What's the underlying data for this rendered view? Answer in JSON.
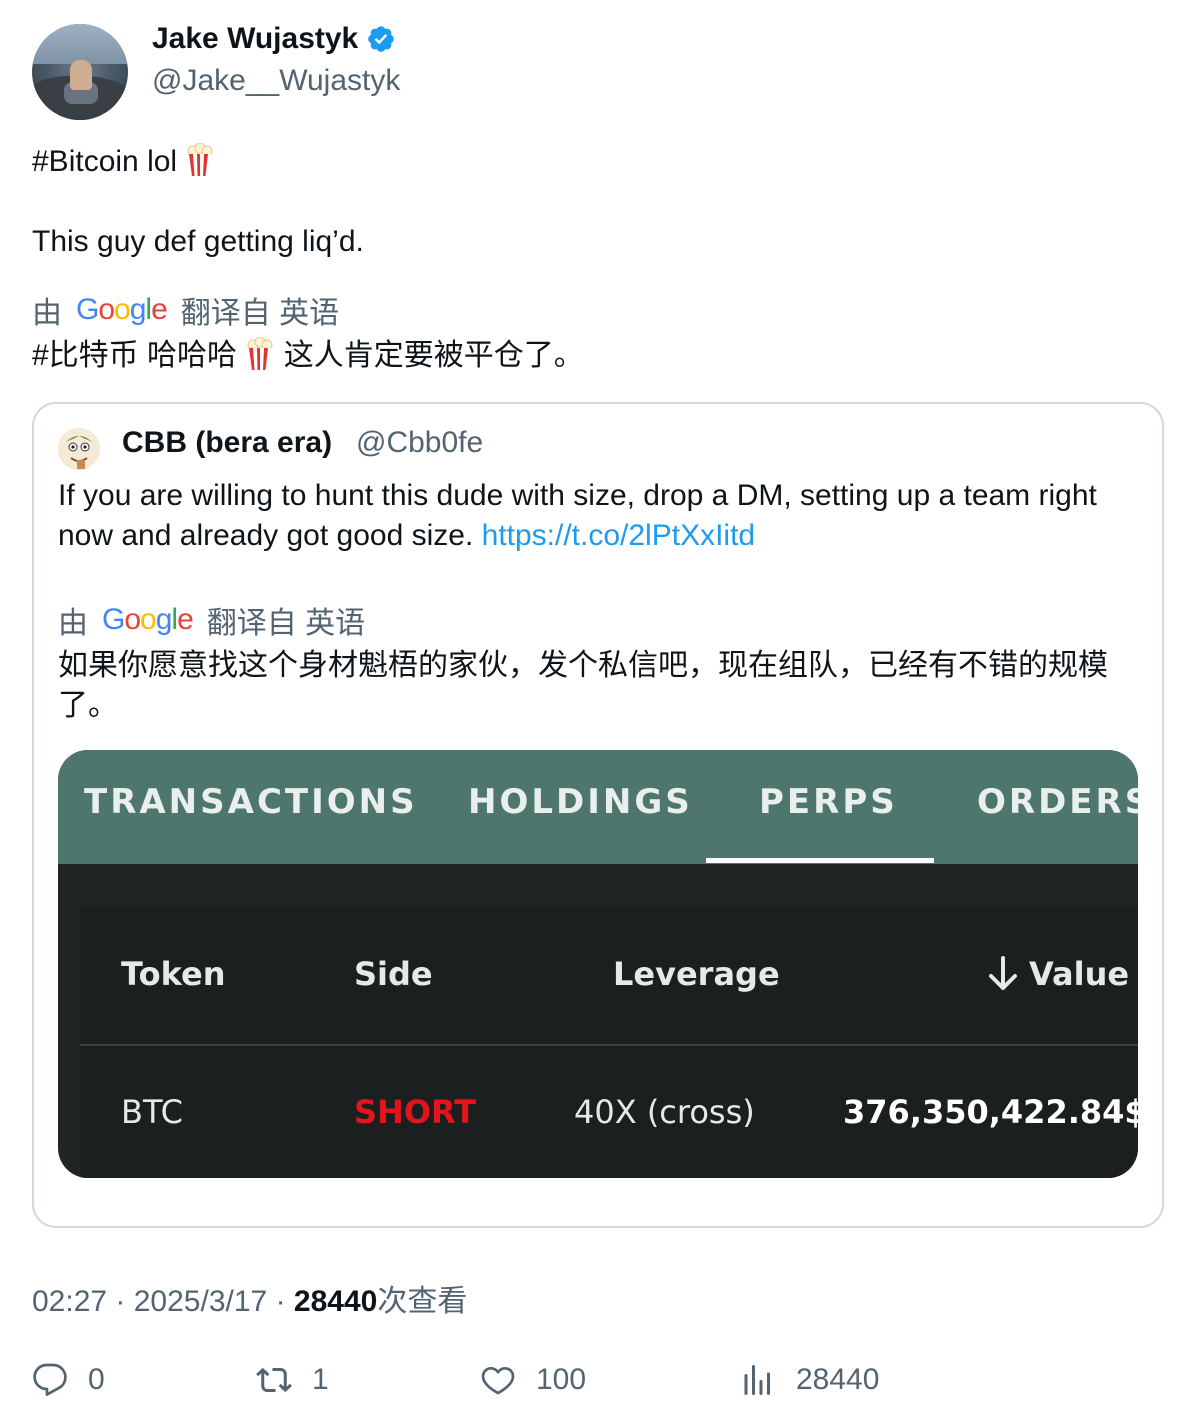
{
  "author": {
    "name": "Jake Wujastyk",
    "handle": "@Jake__Wujastyk",
    "verified": true,
    "verified_color": "#1d9bf0"
  },
  "tweet": {
    "line1": "#Bitcoin lol",
    "line2": "This guy def getting liq’d.",
    "emoji": "popcorn"
  },
  "translation": {
    "prefix": "由",
    "provider": "Google",
    "suffix": "翻译自 英语",
    "text_before_emoji": "#比特币 哈哈哈",
    "text_after_emoji": "这人肯定要被平仓了。"
  },
  "quoted": {
    "name": "CBB (bera era)",
    "handle": "@Cbb0fe",
    "text": "If you are willing to hunt this dude with size, drop a DM, setting up a team right now and already got good size.",
    "link": "https://t.co/2lPtXxIitd",
    "translation_prefix": "由",
    "translation_provider": "Google",
    "translation_suffix": "翻译自 英语",
    "translation_text": "如果你愿意找这个身材魁梧的家伙，发个私信吧，现在组队，已经有不错的规模了。",
    "image": {
      "tabs": [
        "TRANSACTIONS",
        "HOLDINGS",
        "PERPS",
        "ORDERS"
      ],
      "active_tab": "PERPS",
      "columns": [
        "Token",
        "Side",
        "Leverage",
        "Value"
      ],
      "sort_icon": "arrow-down-icon",
      "row": {
        "token": "BTC",
        "side": "SHORT",
        "leverage": "40X (cross)",
        "value": "376,350,422.84$"
      },
      "colors": {
        "tab_bar": "#4f766c",
        "short": "#e5131b",
        "background": "#212526"
      }
    }
  },
  "meta": {
    "time": "02:27",
    "date": "2025/3/17",
    "views": "28440",
    "views_label": "次查看"
  },
  "actions": {
    "replies": "0",
    "retweets": "1",
    "likes": "100",
    "views": "28440"
  }
}
